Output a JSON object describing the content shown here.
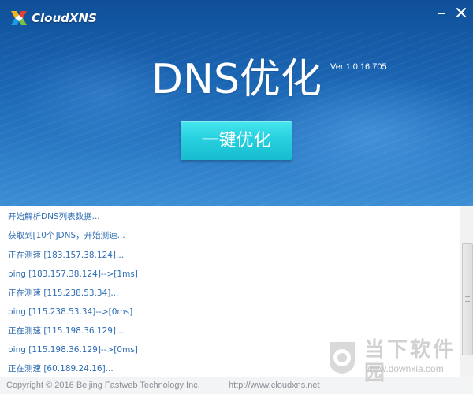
{
  "window": {
    "app_name": "CloudXNS",
    "title": "DNS优化",
    "version": "Ver 1.0.16.705"
  },
  "icons": {
    "logo": "cloudxns-logo-icon",
    "minimize": "minimize-icon",
    "close": "close-icon"
  },
  "optimize_button": {
    "label": "一键优化"
  },
  "log": {
    "lines": [
      "开始解析DNS列表数据...",
      "获取到[10个]DNS，开始测速...",
      "正在测速 [183.157.38.124]...",
      "ping [183.157.38.124]-->[1ms]",
      "正在测速 [115.238.53.34]...",
      "ping [115.238.53.34]-->[0ms]",
      "正在测速 [115.198.36.129]...",
      "ping [115.198.36.129]-->[0ms]",
      "正在测速 [60.189.24.16]..."
    ]
  },
  "footer": {
    "copyright": "Copyright © 2016 Beijing Fastweb Technology Inc.",
    "url": "http://www.cloudxns.net"
  },
  "watermark": {
    "name": "当下软件园",
    "url": "www.downxia.com"
  },
  "colors": {
    "header_blue": "#1b66b4",
    "button_cyan": "#27d0df",
    "log_text": "#2e6db3",
    "footer_text": "#8a8f96"
  }
}
